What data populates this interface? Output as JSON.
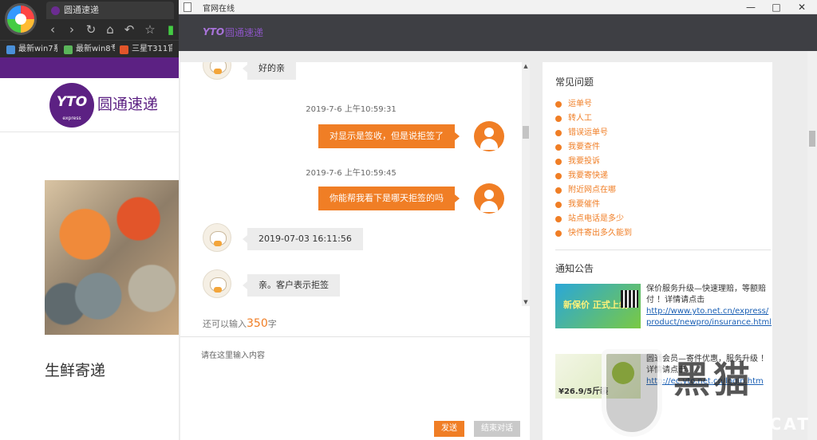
{
  "bg_browser": {
    "tab_title": "圆通速递",
    "bookmarks": [
      "最新win7系",
      "最新win8专",
      "三星T311官"
    ],
    "brand_logo_text": "YTO",
    "brand_logo_sub": "express",
    "brand_name": "圆通速递",
    "section_caption": "生鲜寄递"
  },
  "window": {
    "title": "官网在线",
    "minimize": "—",
    "maximize": "□",
    "close": "✕"
  },
  "header": {
    "logo_text": "YTO",
    "brand": "圆通速递"
  },
  "chat": {
    "messages": [
      {
        "from": "agent",
        "text": "好的亲"
      },
      {
        "timestamp": "2019-7-6 上午10:59:31"
      },
      {
        "from": "user",
        "text": "对显示是签收，但是说拒签了"
      },
      {
        "timestamp": "2019-7-6 上午10:59:45"
      },
      {
        "from": "user",
        "text": "你能帮我看下是哪天拒签的吗"
      },
      {
        "from": "agent",
        "text": "2019-07-03 16:11:56"
      },
      {
        "from": "agent",
        "text": "亲。客户表示拒签"
      }
    ],
    "counter_prefix": "还可以输入",
    "counter_value": "350",
    "counter_suffix": "字",
    "input_placeholder": "请在这里输入内容",
    "send_label": "发送",
    "end_label": "结束对话"
  },
  "faq": {
    "title": "常见问题",
    "items": [
      "运单号",
      "转人工",
      "错误运单号",
      "我要查件",
      "我要投诉",
      "我要寄快递",
      "附近网点在哪",
      "我要催件",
      "站点电话是多少",
      "快件寄出多久能到"
    ]
  },
  "notices": {
    "title": "通知公告",
    "items": [
      {
        "text": "保价服务升级—快速理赔，等额赔付 ！详情请点击",
        "link": "http://www.yto.net.cn/express/product/newpro/insurance.html",
        "image_text": "新保价 正式上线"
      },
      {
        "text": "圆通会员—寄件优惠，服务升级 ！详情请点击",
        "link": "http://ec.yto.net.cn/login.htm",
        "image_text": "¥26.9/5斤装"
      }
    ]
  },
  "watermark": {
    "cn": "黑猫",
    "en": "BLACK CAT"
  },
  "colors": {
    "accent": "#f07e25",
    "brand_purple": "#5c2183",
    "header_dark": "#3e3f44"
  }
}
